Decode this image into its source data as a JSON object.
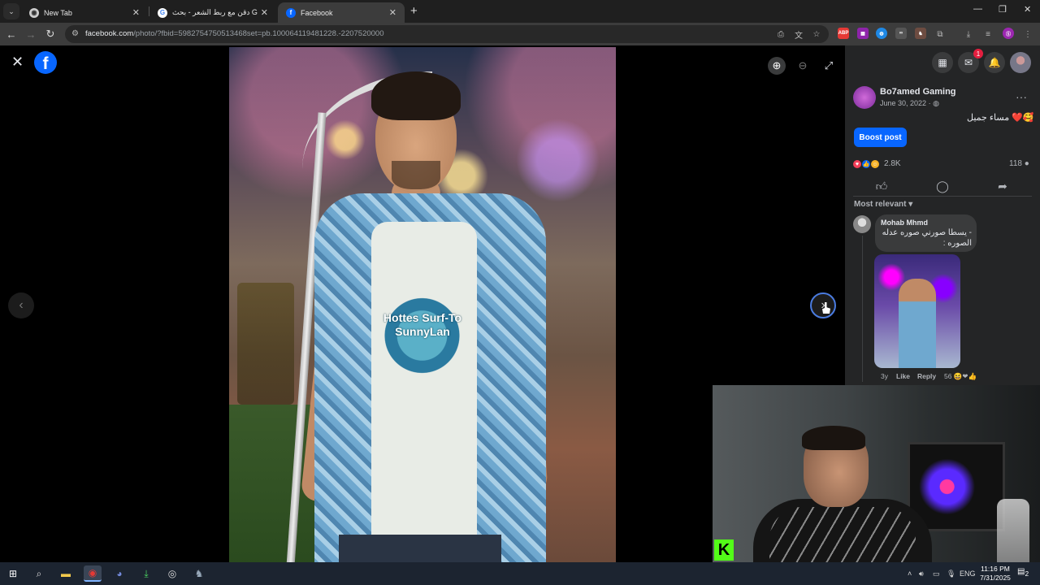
{
  "browser": {
    "tabs": [
      {
        "title": "New Tab"
      },
      {
        "title": "دقن مع ربط الشعر - بحث Google"
      },
      {
        "title": "Facebook"
      }
    ],
    "url_domain": "facebook.com",
    "url_path": "/photo/?fbid=5982754750513468set=pb.100064119481228.-2207520000"
  },
  "post": {
    "page_name": "Bo7amed Gaming",
    "date": "June 30, 2022",
    "caption": "مساء جميل ❤️🥰",
    "boost_label": "Boost post",
    "reactions_count": "2.8K",
    "comments_count": "118",
    "sort_label": "Most relevant"
  },
  "comment": {
    "author": "Mohab Mhmd",
    "text": "- يسطا صورني صوره عدله الصوره :",
    "age": "3y",
    "like_label": "Like",
    "reply_label": "Reply",
    "reaction_count": "56"
  },
  "photo_print": "Hottes Surf-To SunnyLan",
  "notifications_badge": "1",
  "taskbar": {
    "language": "ENG",
    "time": "11:16 PM",
    "date": "7/31/2025",
    "notif_count": "2"
  },
  "colors": {
    "fb_blue": "#0866ff",
    "panel_bg": "#242526",
    "kick_green": "#53fc18"
  }
}
